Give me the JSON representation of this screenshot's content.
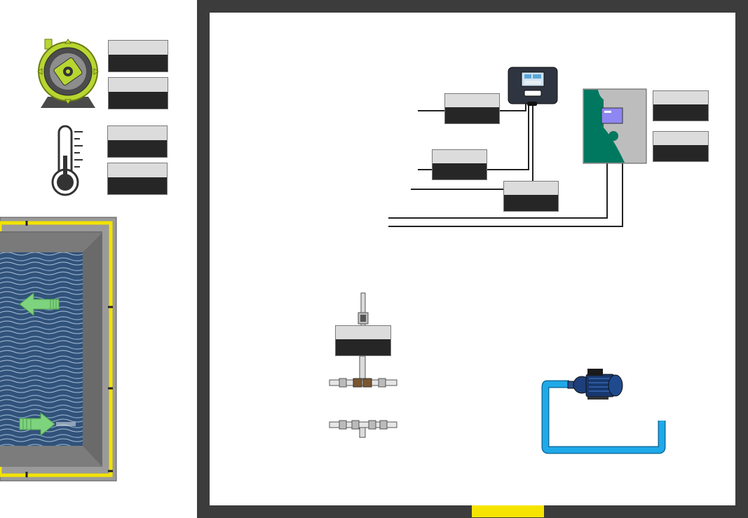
{
  "colors": {
    "wall": "#3c3c3c",
    "door": "#f5e400",
    "pipe_blue": "#1fa9e8",
    "pump_green": "#b7d631",
    "panel_teal": "#00785f",
    "tag_top": "#dcdcdc",
    "tag_bottom": "#262626",
    "arrow_green": "#7ed37e",
    "tank_rim": "#f2e200"
  },
  "icons": {
    "peristaltic_pump": "peristaltic-pump-icon",
    "thermometer": "thermometer-icon",
    "controller": "controller-unit-icon",
    "control_panel": "control-panel-icon",
    "centrifugal_pump": "centrifugal-pump-icon",
    "probe": "probe-holder-icon",
    "pipe_fitting": "pipe-fitting-icon",
    "arrow_inlet": "arrow-left-icon",
    "arrow_outlet": "arrow-right-icon"
  },
  "tags": {
    "pump_1": {
      "label": "",
      "value": ""
    },
    "pump_2": {
      "label": "",
      "value": ""
    },
    "temp_1": {
      "label": "",
      "value": ""
    },
    "temp_2": {
      "label": "",
      "value": ""
    },
    "controller_1": {
      "label": "",
      "value": ""
    },
    "controller_2": {
      "label": "",
      "value": ""
    },
    "controller_3": {
      "label": "",
      "value": ""
    },
    "panel_1": {
      "label": "",
      "value": ""
    },
    "panel_2": {
      "label": "",
      "value": ""
    },
    "probe_1": {
      "label": "",
      "value": ""
    }
  }
}
